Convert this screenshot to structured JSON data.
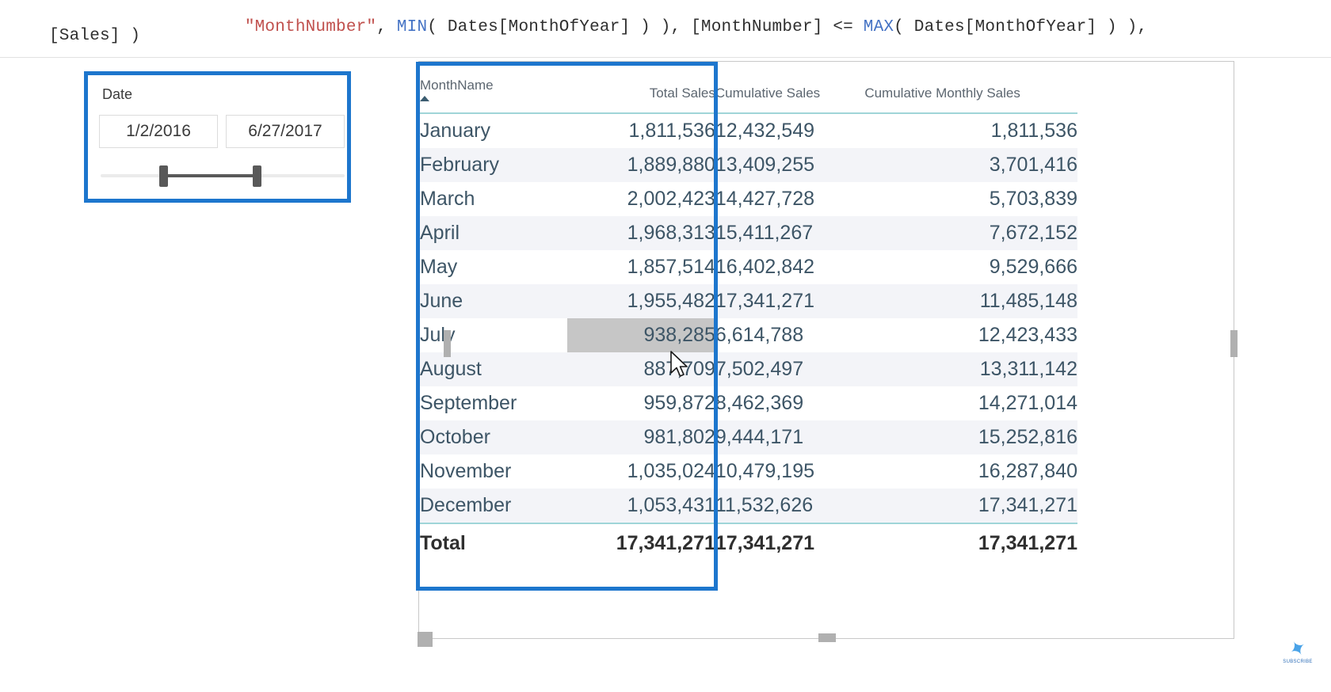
{
  "formula": {
    "line1_parts": [
      {
        "text": "\"MonthNumber\"",
        "kind": "string"
      },
      {
        "text": ", ",
        "kind": "plain"
      },
      {
        "text": "MIN",
        "kind": "function"
      },
      {
        "text": "( Dates[MonthOfYear] ) ), [MonthNumber] <= ",
        "kind": "plain"
      },
      {
        "text": "MAX",
        "kind": "function"
      },
      {
        "text": "( Dates[MonthOfYear] ) ),",
        "kind": "plain"
      }
    ],
    "line1_plain": "\"MonthNumber\", MIN( Dates[MonthOfYear] ) ), [MonthNumber] <= MAX( Dates[MonthOfYear] ) ),",
    "line2": "[Sales] )",
    "colors": {
      "string": "#c0504d",
      "function": "#4472c4",
      "plain": "#2f2f2f"
    }
  },
  "slicer": {
    "title": "Date",
    "start_date": "1/2/2016",
    "end_date": "6/27/2017",
    "highlight_color": "#1d76cd"
  },
  "table": {
    "columns": [
      {
        "key": "month",
        "label": "MonthName",
        "sorted": "ascending"
      },
      {
        "key": "total",
        "label": "Total Sales"
      },
      {
        "key": "cumulative",
        "label": "Cumulative Sales"
      },
      {
        "key": "cumulative_monthly",
        "label": "Cumulative Monthly Sales"
      }
    ],
    "rows": [
      {
        "month": "January",
        "total": "1,811,536",
        "cumulative": "12,432,549",
        "cumulative_monthly": "1,811,536",
        "banded": false,
        "highlight": false
      },
      {
        "month": "February",
        "total": "1,889,880",
        "cumulative": "13,409,255",
        "cumulative_monthly": "3,701,416",
        "banded": true,
        "highlight": false
      },
      {
        "month": "March",
        "total": "2,002,423",
        "cumulative": "14,427,728",
        "cumulative_monthly": "5,703,839",
        "banded": false,
        "highlight": false
      },
      {
        "month": "April",
        "total": "1,968,313",
        "cumulative": "15,411,267",
        "cumulative_monthly": "7,672,152",
        "banded": true,
        "highlight": false
      },
      {
        "month": "May",
        "total": "1,857,514",
        "cumulative": "16,402,842",
        "cumulative_monthly": "9,529,666",
        "banded": false,
        "highlight": false
      },
      {
        "month": "June",
        "total": "1,955,482",
        "cumulative": "17,341,271",
        "cumulative_monthly": "11,485,148",
        "banded": true,
        "highlight": false
      },
      {
        "month": "July",
        "total": "938,285",
        "cumulative": "6,614,788",
        "cumulative_monthly": "12,423,433",
        "banded": false,
        "highlight": true
      },
      {
        "month": "August",
        "total": "887,709",
        "cumulative": "7,502,497",
        "cumulative_monthly": "13,311,142",
        "banded": true,
        "highlight": false
      },
      {
        "month": "September",
        "total": "959,872",
        "cumulative": "8,462,369",
        "cumulative_monthly": "14,271,014",
        "banded": false,
        "highlight": false
      },
      {
        "month": "October",
        "total": "981,802",
        "cumulative": "9,444,171",
        "cumulative_monthly": "15,252,816",
        "banded": true,
        "highlight": false
      },
      {
        "month": "November",
        "total": "1,035,024",
        "cumulative": "10,479,195",
        "cumulative_monthly": "16,287,840",
        "banded": false,
        "highlight": false
      },
      {
        "month": "December",
        "total": "1,053,431",
        "cumulative": "11,532,626",
        "cumulative_monthly": "17,341,271",
        "banded": true,
        "highlight": false
      }
    ],
    "total_row": {
      "month": "Total",
      "total": "17,341,271",
      "cumulative": "17,341,271",
      "cumulative_monthly": "17,341,271"
    },
    "highlight_box_color": "#1d76cd"
  },
  "watermark": {
    "glyph": "✦",
    "label": "SUBSCRIBE"
  },
  "cursor": {
    "icon": "mouse-pointer"
  }
}
